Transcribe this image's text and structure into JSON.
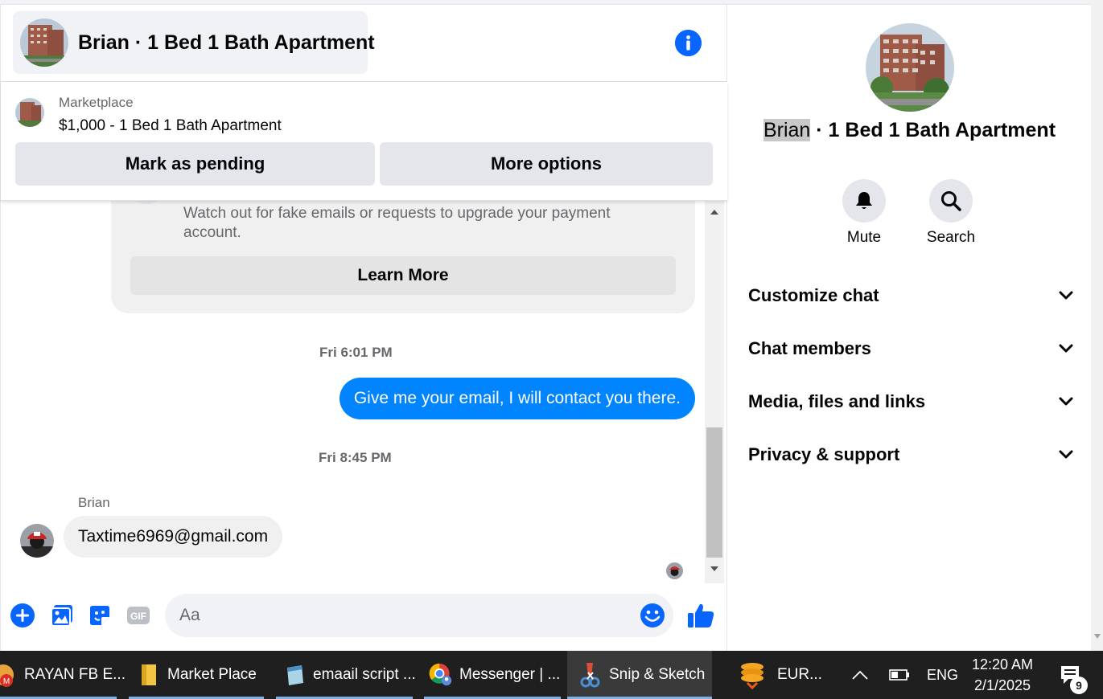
{
  "header": {
    "title": "Brian · 1 Bed 1 Bath Apartment"
  },
  "marketplace": {
    "label": "Marketplace",
    "listing": "$1,000 - 1 Bed 1 Bath Apartment",
    "pending_label": "Mark as pending",
    "more_label": "More options"
  },
  "warning": {
    "text": "Watch out for fake emails or requests to upgrade your payment account.",
    "learn_more_label": "Learn More"
  },
  "messages": {
    "time_1": "Fri 6:01 PM",
    "outgoing_1": "Give me your email, I will contact you there.",
    "time_2": "Fri 8:45 PM",
    "sender": "Brian",
    "incoming_1": "Taxtime6969@gmail.com"
  },
  "composer": {
    "placeholder": "Aa"
  },
  "details": {
    "name_highlight": "Brian",
    "name_rest": " · 1 Bed 1 Bath Apartment",
    "mute_label": "Mute",
    "search_label": "Search",
    "sections": [
      "Customize chat",
      "Chat members",
      "Media, files and links",
      "Privacy & support"
    ]
  },
  "taskbar": {
    "items": [
      "RAYAN FB E...",
      "Market Place",
      "emaail script ...",
      "Messenger | ...",
      "Snip & Sketch",
      "EUR..."
    ],
    "language": "ENG",
    "time": "12:20 AM",
    "date": "2/1/2025",
    "notification_count": "9"
  },
  "colors": {
    "accent": "#0866ff",
    "outgoing_bubble": "#0084ff",
    "incoming_bubble": "#f0f0f0",
    "taskbar": "#1f1f1f"
  }
}
